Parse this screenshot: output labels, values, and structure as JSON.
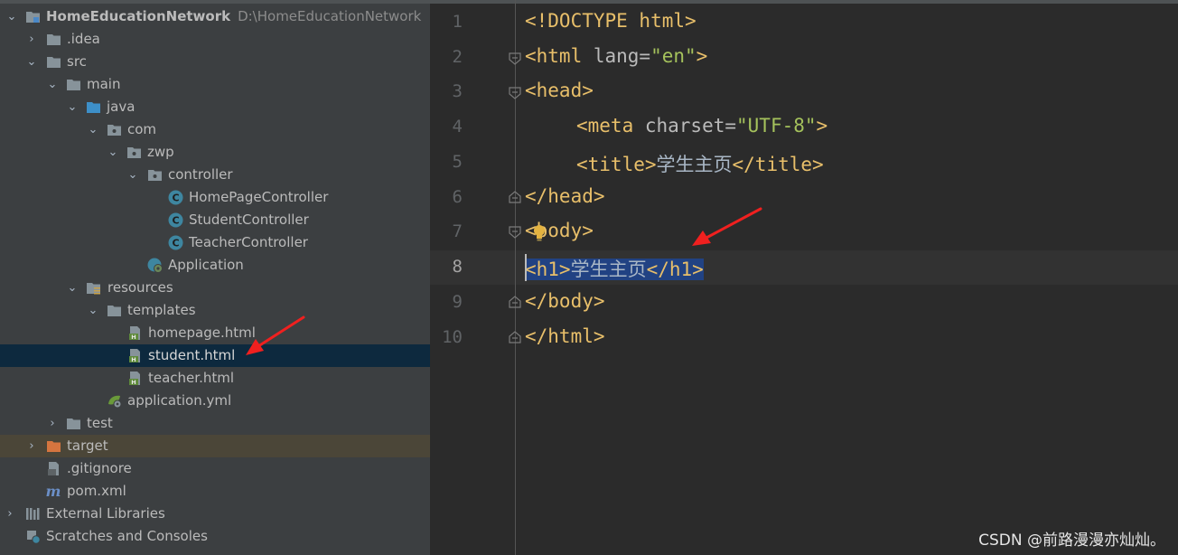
{
  "project": {
    "name": "HomeEducationNetwork",
    "path": "D:\\HomeEducationNetwork"
  },
  "tree": {
    "idea": ".idea",
    "src": "src",
    "main": "main",
    "java": "java",
    "com": "com",
    "zwp": "zwp",
    "controller": "controller",
    "homepage_controller": "HomePageController",
    "student_controller": "StudentController",
    "teacher_controller": "TeacherController",
    "application": "Application",
    "resources": "resources",
    "templates": "templates",
    "homepage_html": "homepage.html",
    "student_html": "student.html",
    "teacher_html": "teacher.html",
    "application_yml": "application.yml",
    "test": "test",
    "target": "target",
    "gitignore": ".gitignore",
    "pom": "pom.xml",
    "external_libraries": "External Libraries",
    "scratches": "Scratches and Consoles"
  },
  "editor": {
    "line_numbers": [
      "1",
      "2",
      "3",
      "4",
      "5",
      "6",
      "7",
      "8",
      "9",
      "10"
    ],
    "doctype": "<!DOCTYPE html>",
    "html_open": "<html",
    "lang_attr": " lang=",
    "lang_val": "\"en\"",
    "gt": ">",
    "head_open": "<head>",
    "meta_open": "<meta",
    "charset_attr": " charset=",
    "charset_val": "\"UTF-8\"",
    "title_open": "<title>",
    "title_text": "学生主页",
    "title_close": "</title>",
    "head_close": "</head>",
    "body_open": "<body>",
    "h1_open": "<h1>",
    "h1_text": "学生主页",
    "h1_close": "</h1>",
    "body_close": "</body>",
    "html_close": "</html>"
  },
  "watermark": "CSDN @前路漫漫亦灿灿。",
  "colors": {
    "tag": "#e8bf6a",
    "attr_value": "#a5c25c",
    "selection": "#214283",
    "arrow": "#f0201f"
  }
}
